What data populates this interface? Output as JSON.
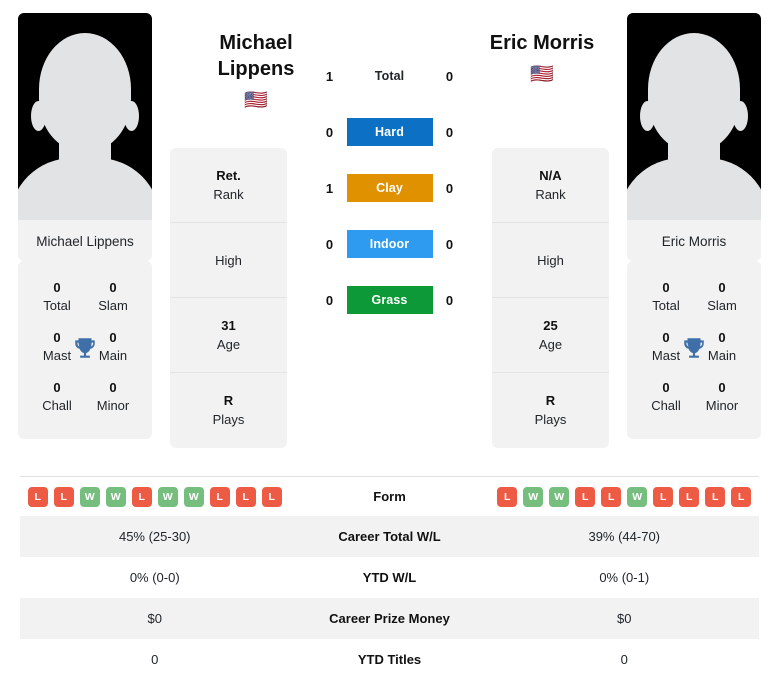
{
  "colors": {
    "hard": "#0c70c4",
    "clay": "#df9100",
    "indoor": "#2e9bf0",
    "grass": "#0e9938",
    "win": "#76be7e",
    "loss": "#ee5b45",
    "trophy": "#3e6fa8",
    "card_bg": "#f2f2f3"
  },
  "players": {
    "left": {
      "name": "Michael Lippens",
      "name_line1": "Michael",
      "name_line2": "Lippens",
      "flag": "🇺🇸",
      "photo_name": "Michael Lippens",
      "titles": [
        {
          "num": "0",
          "label": "Total"
        },
        {
          "num": "0",
          "label": "Slam"
        },
        {
          "num": "0",
          "label": "Mast"
        },
        {
          "num": "0",
          "label": "Main"
        },
        {
          "num": "0",
          "label": "Chall"
        },
        {
          "num": "0",
          "label": "Minor"
        }
      ],
      "info": [
        {
          "value": "Ret.",
          "caption": "Rank"
        },
        {
          "value": "",
          "caption": "High"
        },
        {
          "value": "31",
          "caption": "Age"
        },
        {
          "value": "R",
          "caption": "Plays"
        }
      ],
      "surface_scores": {
        "total": "1",
        "hard": "0",
        "clay": "1",
        "indoor": "0",
        "grass": "0"
      },
      "form": [
        "L",
        "L",
        "W",
        "W",
        "L",
        "W",
        "W",
        "L",
        "L",
        "L"
      ],
      "stats": {
        "career_total_wl": "45% (25-30)",
        "ytd_wl": "0% (0-0)",
        "career_prize_money": "$0",
        "ytd_titles": "0"
      }
    },
    "right": {
      "name": "Eric Morris",
      "name_line1": "Eric Morris",
      "name_line2": "",
      "flag": "🇺🇸",
      "photo_name": "Eric Morris",
      "titles": [
        {
          "num": "0",
          "label": "Total"
        },
        {
          "num": "0",
          "label": "Slam"
        },
        {
          "num": "0",
          "label": "Mast"
        },
        {
          "num": "0",
          "label": "Main"
        },
        {
          "num": "0",
          "label": "Chall"
        },
        {
          "num": "0",
          "label": "Minor"
        }
      ],
      "info": [
        {
          "value": "N/A",
          "caption": "Rank"
        },
        {
          "value": "",
          "caption": "High"
        },
        {
          "value": "25",
          "caption": "Age"
        },
        {
          "value": "R",
          "caption": "Plays"
        }
      ],
      "surface_scores": {
        "total": "0",
        "hard": "0",
        "clay": "0",
        "indoor": "0",
        "grass": "0"
      },
      "form": [
        "L",
        "W",
        "W",
        "L",
        "L",
        "W",
        "L",
        "L",
        "L",
        "L"
      ],
      "stats": {
        "career_total_wl": "39% (44-70)",
        "ytd_wl": "0% (0-1)",
        "career_prize_money": "$0",
        "ytd_titles": "0"
      }
    }
  },
  "surfaces": [
    {
      "key": "total",
      "label": "Total",
      "color": ""
    },
    {
      "key": "hard",
      "label": "Hard",
      "color": "#0c70c4"
    },
    {
      "key": "clay",
      "label": "Clay",
      "color": "#df9100"
    },
    {
      "key": "indoor",
      "label": "Indoor",
      "color": "#2e9bf0"
    },
    {
      "key": "grass",
      "label": "Grass",
      "color": "#0e9938"
    }
  ],
  "table": {
    "rows": [
      {
        "label": "Form",
        "key": "form",
        "type": "form"
      },
      {
        "label": "Career Total W/L",
        "key": "career_total_wl",
        "type": "text"
      },
      {
        "label": "YTD W/L",
        "key": "ytd_wl",
        "type": "text"
      },
      {
        "label": "Career Prize Money",
        "key": "career_prize_money",
        "type": "text"
      },
      {
        "label": "YTD Titles",
        "key": "ytd_titles",
        "type": "text"
      }
    ]
  }
}
